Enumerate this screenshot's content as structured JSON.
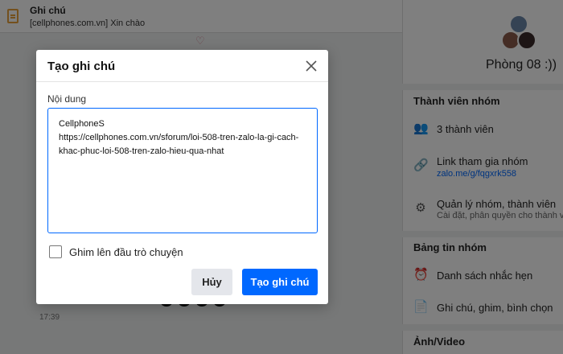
{
  "pinned_note": {
    "title": "Ghi chú",
    "subtitle": "[cellphones.com.vn] Xin chào"
  },
  "chat": {
    "timestamp": "17:39"
  },
  "sidebar": {
    "group_name": "Phòng 08 :))",
    "members_section": {
      "title": "Thành viên nhóm",
      "member_count": "3 thành viên",
      "join_link_label": "Link tham gia nhóm",
      "join_link": "zalo.me/g/fqgxrk558",
      "manage_label": "Quản lý nhóm, thành viên",
      "manage_sub": "Cài đặt, phân quyền cho thành viên"
    },
    "board_section": {
      "title": "Bảng tin nhóm",
      "reminders": "Danh sách nhắc hẹn",
      "notes": "Ghi chú, ghim, bình chọn"
    },
    "media_section": {
      "title": "Ảnh/Video"
    }
  },
  "modal": {
    "title": "Tạo ghi chú",
    "content_label": "Nội dung",
    "content_value": "CellphoneS\nhttps://cellphones.com.vn/sforum/loi-508-tren-zalo-la-gi-cach-khac-phuc-loi-508-tren-zalo-hieu-qua-nhat",
    "pin_label": "Ghim lên đầu trò chuyện",
    "pin_checked": false,
    "cancel_label": "Hủy",
    "submit_label": "Tạo ghi chú"
  },
  "colors": {
    "accent": "#0068ff",
    "note_icon": "#e8a13a"
  }
}
